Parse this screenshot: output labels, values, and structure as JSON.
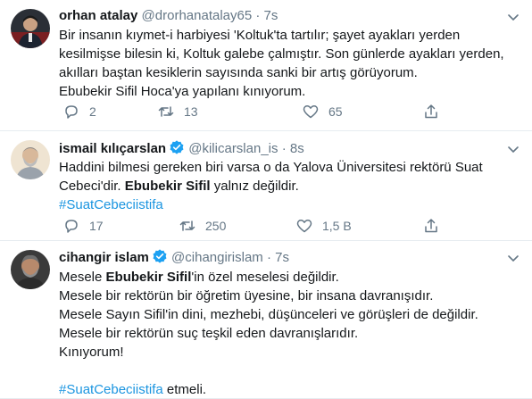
{
  "tweets": [
    {
      "name": "orhan atalay",
      "handle": "@drorhanatalay65",
      "sep": "·",
      "time": "7s",
      "verified": false,
      "lines": [
        [
          {
            "t": "Bir insanın kıymet-i harbiyesi  'Koltuk'ta tartılır; şayet ayakları yerden"
          }
        ],
        [
          {
            "t": "kesilmişse bilesin ki, Koltuk galebe çalmıştır. Son günlerde ayakları yerden,"
          }
        ],
        [
          {
            "t": "akılları baştan kesiklerin sayısında sanki bir artış görüyorum."
          }
        ],
        [
          {
            "t": "Ebubekir Sifil Hoca'ya yapılanı kınıyorum."
          }
        ]
      ],
      "replies": "2",
      "retweets": "13",
      "likes": "65"
    },
    {
      "name": "ismail kılıçarslan",
      "handle": "@kilicarslan_is",
      "sep": "·",
      "time": "8s",
      "verified": true,
      "lines": [
        [
          {
            "t": "Haddini bilmesi gereken biri varsa o da Yalova Üniversitesi rektörü Suat"
          }
        ],
        [
          {
            "t": "Cebeci'dir. "
          },
          {
            "t": "Ebubekir Sifil",
            "b": true
          },
          {
            "t": " yalnız değildir."
          }
        ],
        [
          {
            "t": "#SuatCebeciistifa",
            "tag": true
          }
        ]
      ],
      "replies": "17",
      "retweets": "250",
      "likes": "1,5 B"
    },
    {
      "name": "cihangir islam",
      "handle": "@cihangirislam",
      "sep": "·",
      "time": "7s",
      "verified": true,
      "lines": [
        [
          {
            "t": "Mesele "
          },
          {
            "t": "Ebubekir Sifil",
            "b": true
          },
          {
            "t": "'in özel meselesi değildir."
          }
        ],
        [
          {
            "t": "Mesele bir rektörün bir öğretim üyesine, bir insana davranışıdır."
          }
        ],
        [
          {
            "t": "Mesele Sayın Sifil'in dini, mezhebi, düşünceleri ve görüşleri de değildir."
          }
        ],
        [
          {
            "t": "Mesele bir rektörün suç teşkil eden davranışlarıdır."
          }
        ],
        [
          {
            "t": "Kınıyorum!"
          }
        ],
        [
          {
            "t": ""
          }
        ],
        [
          {
            "t": "#SuatCebeciistifa",
            "tag": true
          },
          {
            "t": " etmeli."
          }
        ]
      ]
    }
  ],
  "colors": {
    "text": "#14171a",
    "secondary": "#657786",
    "link": "#1b95e0",
    "verified": "#1da1f2",
    "divider": "#e6ecf0"
  },
  "icons": [
    "reply-icon",
    "retweet-icon",
    "like-icon",
    "share-icon",
    "verified-badge-icon",
    "chevron-down-icon"
  ]
}
